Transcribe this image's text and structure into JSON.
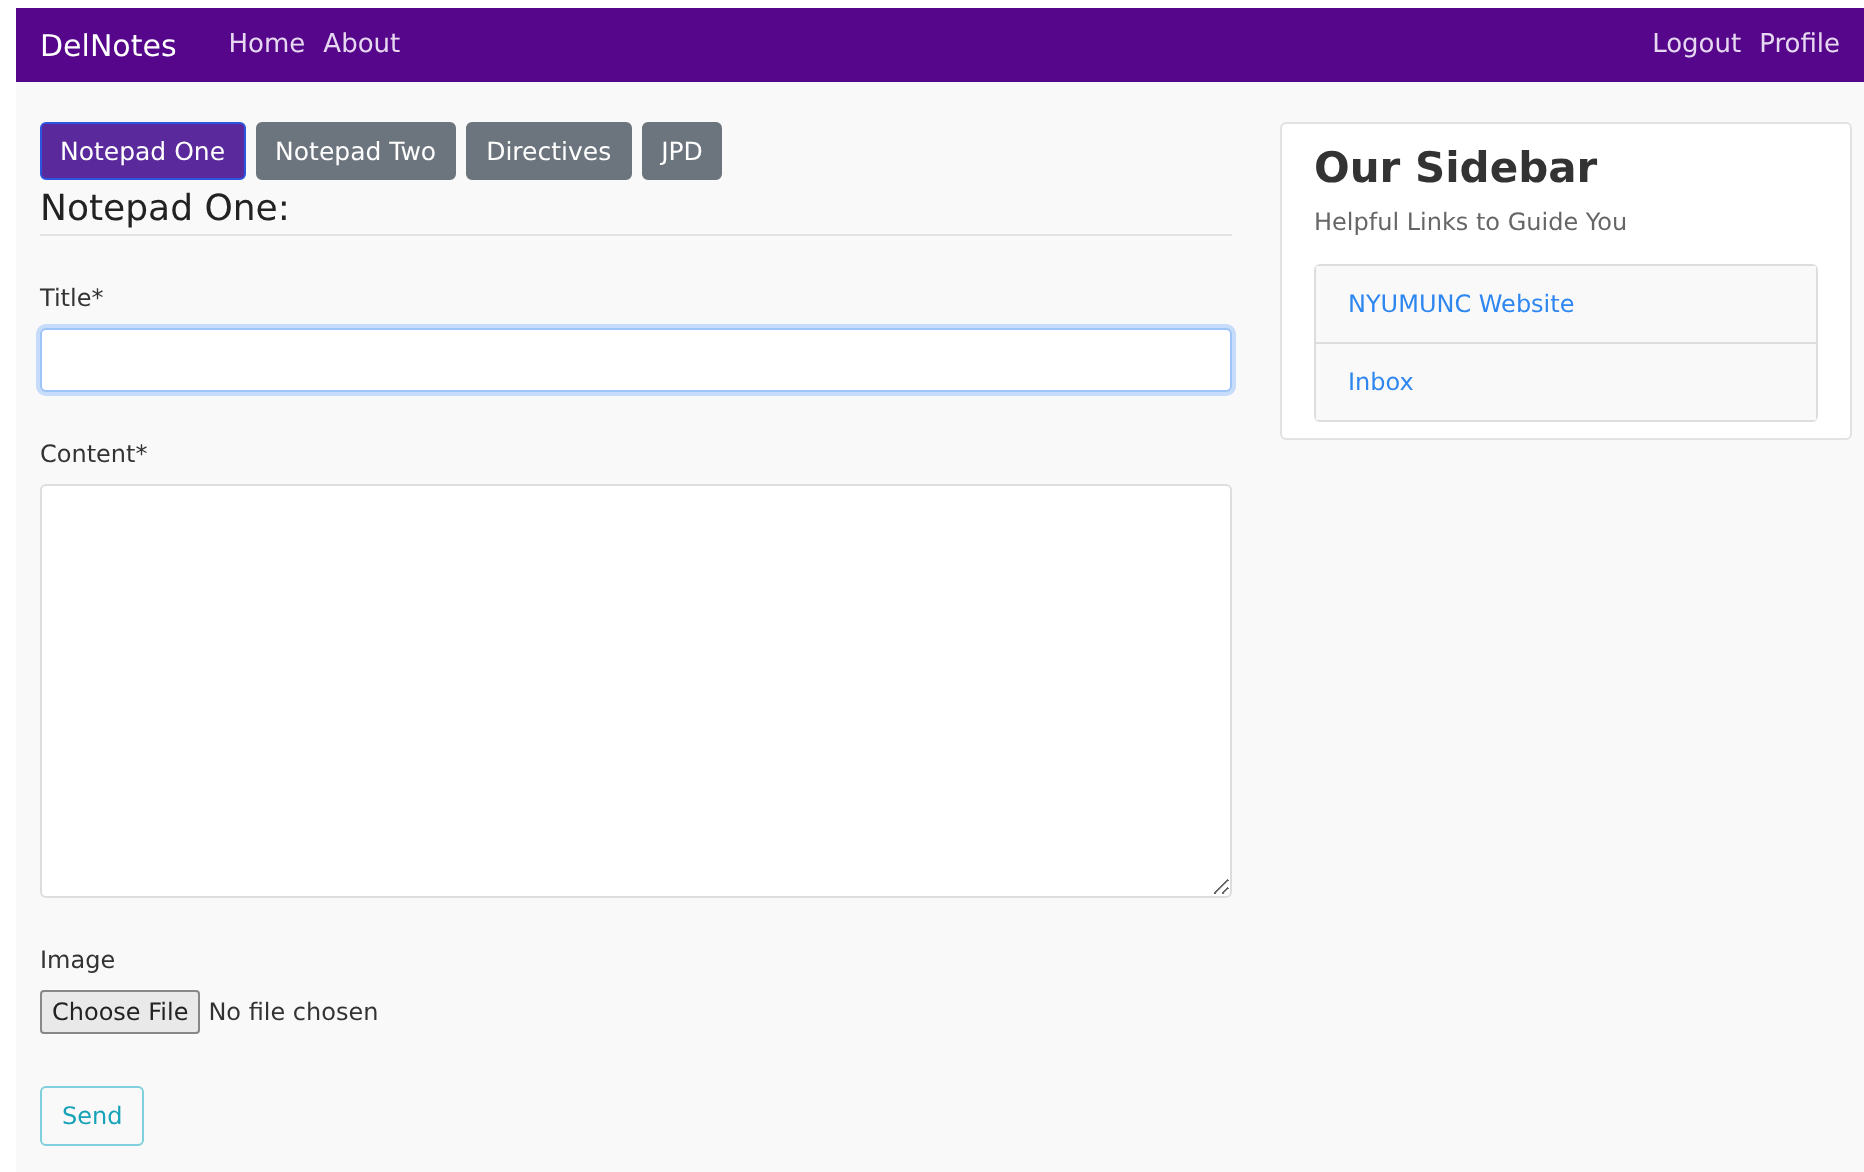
{
  "navbar": {
    "brand": "DelNotes",
    "left_links": [
      "Home",
      "About"
    ],
    "right_links": [
      "Logout",
      "Profile"
    ]
  },
  "tabs": [
    {
      "label": "Notepad One",
      "selected": true
    },
    {
      "label": "Notepad Two",
      "selected": false
    },
    {
      "label": "Directives",
      "selected": false
    },
    {
      "label": "JPD",
      "selected": false
    }
  ],
  "heading": "Notepad One:",
  "form": {
    "title_label": "Title*",
    "title_focused": true,
    "content_label": "Content*",
    "image_label": "Image",
    "file_button": "Choose File",
    "file_status": "No file chosen",
    "submit": "Send"
  },
  "sidebar": {
    "title": "Our Sidebar",
    "subtitle": "Helpful Links to Guide You",
    "links": [
      "NYUMUNC Website",
      "Inbox"
    ]
  }
}
